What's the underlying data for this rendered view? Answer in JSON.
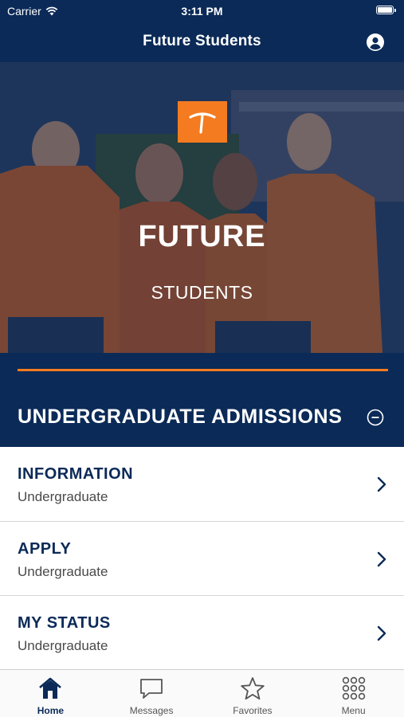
{
  "status_bar": {
    "carrier": "Carrier",
    "time": "3:11 PM",
    "battery_level": 1.0
  },
  "nav": {
    "title": "Future Students",
    "account_icon": "account-circle-icon"
  },
  "hero": {
    "title": "FUTURE",
    "subtitle": "STUDENTS",
    "logo_icon": "pickaxe-icon"
  },
  "section": {
    "title": "UNDERGRADUATE ADMISSIONS",
    "collapse_icon": "minus-circle-icon"
  },
  "items": [
    {
      "title": "INFORMATION",
      "subtitle": "Undergraduate"
    },
    {
      "title": "APPLY",
      "subtitle": "Undergraduate"
    },
    {
      "title": "MY STATUS",
      "subtitle": "Undergraduate"
    }
  ],
  "tabs": [
    {
      "label": "Home",
      "icon": "home-icon",
      "active": true
    },
    {
      "label": "Messages",
      "icon": "chat-bubble-icon",
      "active": false
    },
    {
      "label": "Favorites",
      "icon": "star-icon",
      "active": false
    },
    {
      "label": "Menu",
      "icon": "grid-dots-icon",
      "active": false
    }
  ],
  "colors": {
    "navy": "#0b2a57",
    "orange": "#f47b20"
  }
}
